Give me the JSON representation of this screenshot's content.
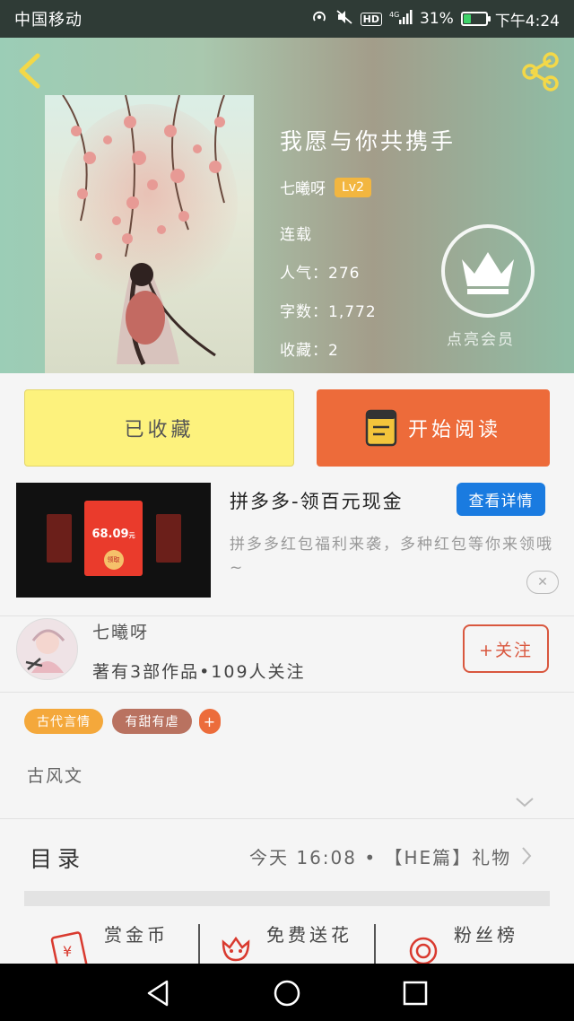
{
  "status_bar": {
    "carrier": "中国移动",
    "battery": "31%",
    "time": "下午4:24",
    "network": "4G",
    "hd": "HD",
    "battery_level": 0.31
  },
  "book": {
    "title": "我愿与你共携手",
    "author": "七曦呀",
    "level": "Lv2",
    "status": "连载",
    "popularity": "人气：276",
    "word_count": "字数：1,772",
    "favorites": "收藏：2",
    "vip_label": "点亮会员"
  },
  "actions": {
    "collect_label": "已收藏",
    "read_label": "开始阅读"
  },
  "ad": {
    "title": "拼多多-领百元现金",
    "detail_button": "查看详情",
    "description": "拼多多红包福利来袭，多种红包等你来领哦~",
    "card_amount": "68.09",
    "card_unit": "元",
    "card_claim": "领取",
    "close": "✕"
  },
  "author_section": {
    "name": "七曦呀",
    "stats": "著有3部作品•109人关注",
    "follow_button": "+关注"
  },
  "tags": [
    "古代言情",
    "有甜有虐"
  ],
  "tag_add": "+",
  "description": "古风文",
  "toc": {
    "label": "目录",
    "latest": "今天 16:08 • 【HE篇】礼物"
  },
  "bottom_actions": [
    {
      "label": "赏金币",
      "icon": "red-envelope-icon"
    },
    {
      "label": "免费送花",
      "icon": "flower-icon"
    },
    {
      "label": "粉丝榜",
      "icon": "medal-icon"
    }
  ],
  "colors": {
    "accent_orange": "#ed6b3a",
    "collect_yellow": "#fdf27d",
    "link_blue": "#1a7be0"
  }
}
